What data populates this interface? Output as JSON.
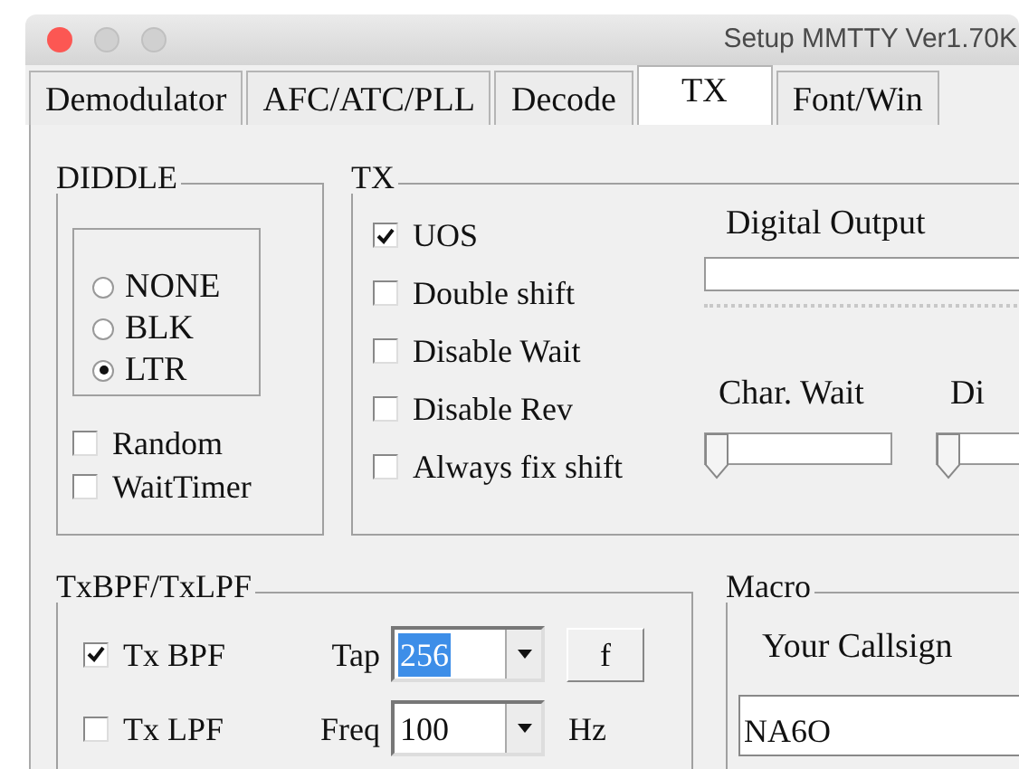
{
  "window": {
    "title": "Setup MMTTY Ver1.70K"
  },
  "tabs": [
    {
      "label": "Demodulator",
      "selected": false
    },
    {
      "label": "AFC/ATC/PLL",
      "selected": false
    },
    {
      "label": "Decode",
      "selected": false
    },
    {
      "label": "TX",
      "selected": true
    },
    {
      "label": "Font/Win",
      "selected": false
    }
  ],
  "diddle": {
    "title": "DIDDLE",
    "options": [
      {
        "label": "NONE",
        "selected": false
      },
      {
        "label": "BLK",
        "selected": false
      },
      {
        "label": "LTR",
        "selected": true
      }
    ],
    "checkboxes": [
      {
        "label": "Random",
        "checked": false
      },
      {
        "label": "WaitTimer",
        "checked": false
      }
    ]
  },
  "tx": {
    "title": "TX",
    "checkboxes": [
      {
        "label": "UOS",
        "checked": true
      },
      {
        "label": "Double shift",
        "checked": false
      },
      {
        "label": "Disable Wait",
        "checked": false
      },
      {
        "label": "Disable Rev",
        "checked": false
      },
      {
        "label": "Always fix shift",
        "checked": false
      }
    ],
    "digital_output": {
      "label": "Digital Output"
    },
    "sliders": [
      {
        "label": "Char. Wait",
        "level": 0
      },
      {
        "label": "Di",
        "level": 0
      }
    ]
  },
  "filters": {
    "title": "TxBPF/TxLPF",
    "rows": [
      {
        "checkbox": {
          "label": "Tx BPF",
          "checked": true
        },
        "field_label": "Tap",
        "value": "256",
        "text_selected": true,
        "button": "f"
      },
      {
        "checkbox": {
          "label": "Tx LPF",
          "checked": false
        },
        "field_label": "Freq",
        "value": "100",
        "text_selected": false,
        "unit": "Hz"
      }
    ]
  },
  "macro": {
    "title": "Macro",
    "callsign_label": "Your Callsign",
    "callsign": "NA6O"
  }
}
